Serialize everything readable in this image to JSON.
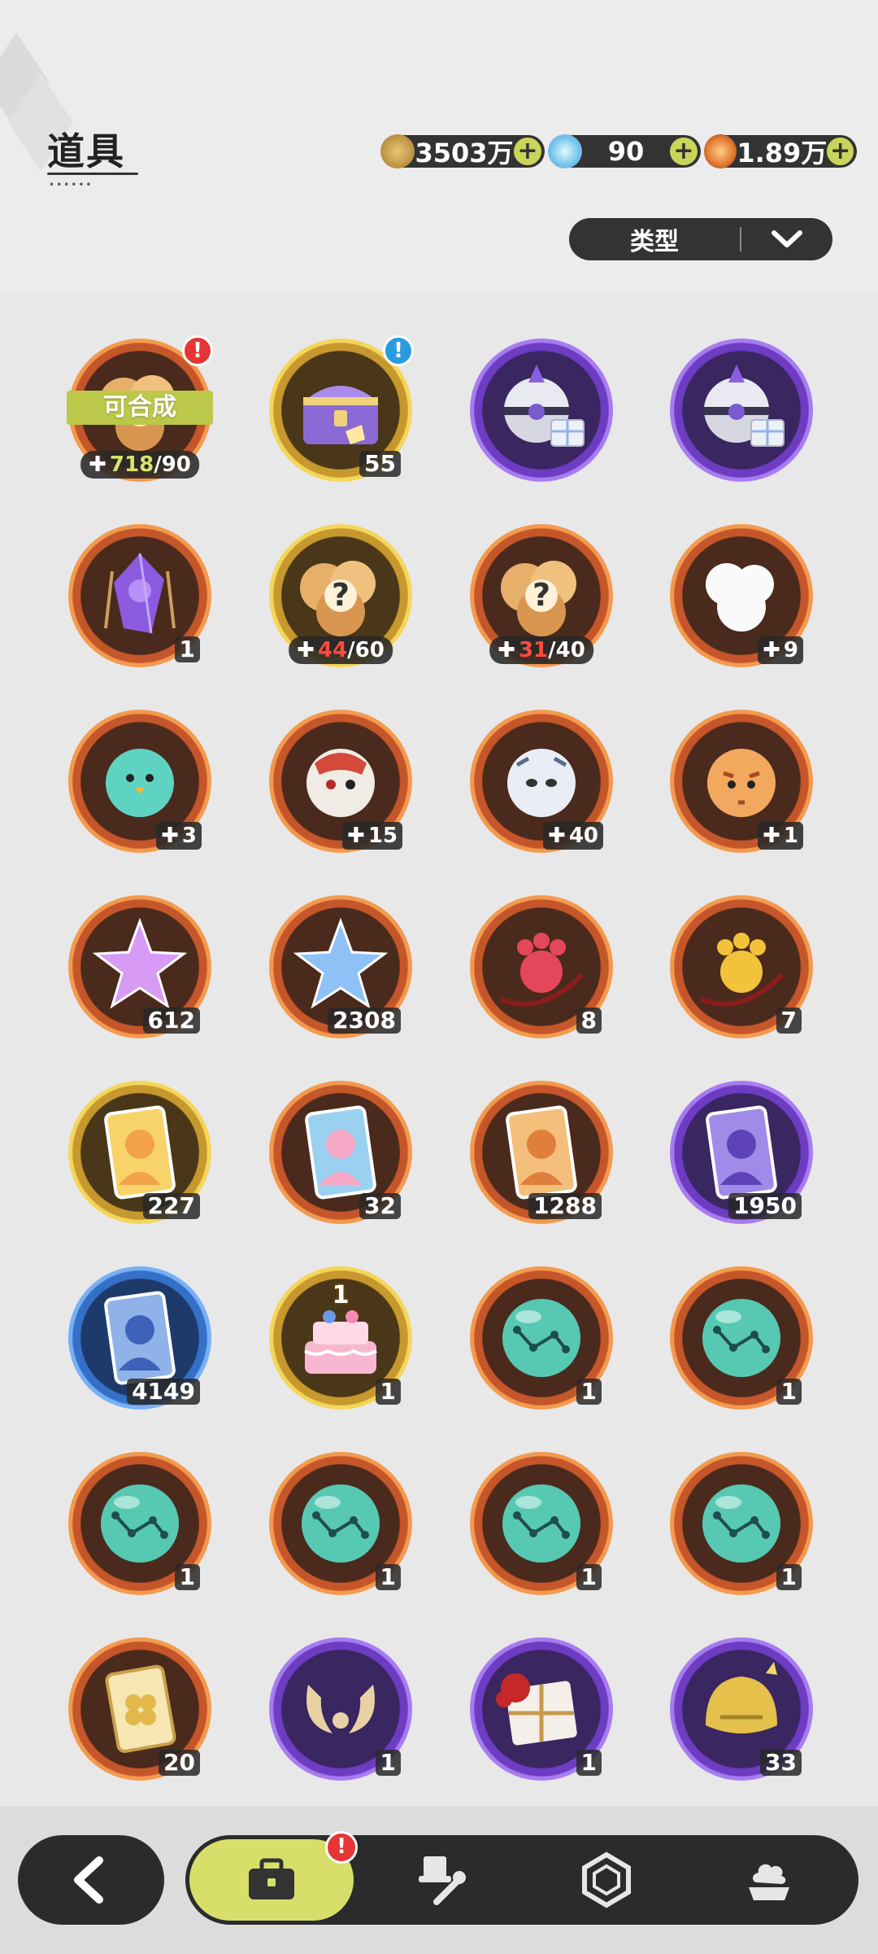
{
  "header": {
    "title": "道具",
    "currencies": [
      {
        "name": "gold-coin",
        "value": "3503万",
        "color": "#c9a04a"
      },
      {
        "name": "crystal",
        "value": "90",
        "color": "#7ad0f0"
      },
      {
        "name": "star-gem",
        "value": "1.89万",
        "color": "#e07a3a"
      }
    ],
    "filter_label": "类型"
  },
  "items": [
    {
      "ring": "orange",
      "icon": "fragment-pile-icon",
      "badge": "!",
      "badge_color": "red",
      "craft": "可合成",
      "frag_current": "718",
      "frag_total": "/90",
      "frag_color": "green"
    },
    {
      "ring": "gold",
      "icon": "treasure-chest-icon",
      "badge": "!",
      "badge_color": "blue",
      "count": "55"
    },
    {
      "ring": "purple",
      "icon": "capsule-gift-icon"
    },
    {
      "ring": "purple",
      "icon": "capsule-gift-icon"
    },
    {
      "ring": "orange",
      "icon": "purple-crystal-lantern-icon",
      "count": "1"
    },
    {
      "ring": "gold",
      "icon": "mystery-fragment-icon",
      "frag_current": "44",
      "frag_total": "/60",
      "frag_color": "red"
    },
    {
      "ring": "orange",
      "icon": "mystery-fragment-icon",
      "frag_current": "31",
      "frag_total": "/40",
      "frag_color": "red"
    },
    {
      "ring": "orange",
      "icon": "white-fragment-icon",
      "small_frag": "9"
    },
    {
      "ring": "orange",
      "icon": "teal-bird-fragment-icon",
      "small_frag": "3"
    },
    {
      "ring": "orange",
      "icon": "red-mask-fragment-icon",
      "small_frag": "15"
    },
    {
      "ring": "orange",
      "icon": "white-tiger-fragment-icon",
      "small_frag": "40"
    },
    {
      "ring": "orange",
      "icon": "orange-tiger-fragment-icon",
      "small_frag": "1"
    },
    {
      "ring": "orange",
      "icon": "pink-star-crystal-icon",
      "count": "612"
    },
    {
      "ring": "orange",
      "icon": "blue-star-crystal-icon",
      "count": "2308"
    },
    {
      "ring": "orange",
      "icon": "red-paw-ornament-icon",
      "count": "8"
    },
    {
      "ring": "orange",
      "icon": "gold-paw-ornament-icon",
      "count": "7"
    },
    {
      "ring": "gold",
      "icon": "gold-character-card-icon",
      "count": "227"
    },
    {
      "ring": "orange",
      "icon": "rainbow-character-card-icon",
      "count": "32"
    },
    {
      "ring": "orange",
      "icon": "orange-character-card-icon",
      "count": "1288"
    },
    {
      "ring": "purple",
      "icon": "purple-character-card-icon",
      "count": "1950"
    },
    {
      "ring": "blue",
      "icon": "blue-character-card-icon",
      "count": "4149"
    },
    {
      "ring": "gold",
      "icon": "birthday-cake-icon",
      "cake_num": "1",
      "count": "1"
    },
    {
      "ring": "orange",
      "icon": "constellation-orb-icon",
      "count": "1"
    },
    {
      "ring": "orange",
      "icon": "constellation-orb-icon",
      "count": "1"
    },
    {
      "ring": "orange",
      "icon": "constellation-orb-icon",
      "count": "1"
    },
    {
      "ring": "orange",
      "icon": "constellation-orb-icon",
      "count": "1"
    },
    {
      "ring": "orange",
      "icon": "constellation-orb-icon",
      "count": "1"
    },
    {
      "ring": "orange",
      "icon": "constellation-orb-icon",
      "count": "1"
    },
    {
      "ring": "orange",
      "icon": "clover-ticket-icon",
      "count": "20"
    },
    {
      "ring": "purple",
      "icon": "golden-horns-icon",
      "count": "1"
    },
    {
      "ring": "purple",
      "icon": "red-gift-box-icon",
      "count": "1"
    },
    {
      "ring": "purple",
      "icon": "golden-helmet-icon",
      "count": "33"
    }
  ],
  "nav": {
    "badge": "!",
    "tabs": [
      {
        "name": "back-icon"
      },
      {
        "name": "bag-icon",
        "active": true
      },
      {
        "name": "hat-tool-icon"
      },
      {
        "name": "hexagon-gem-icon"
      },
      {
        "name": "dessert-icon"
      }
    ]
  }
}
